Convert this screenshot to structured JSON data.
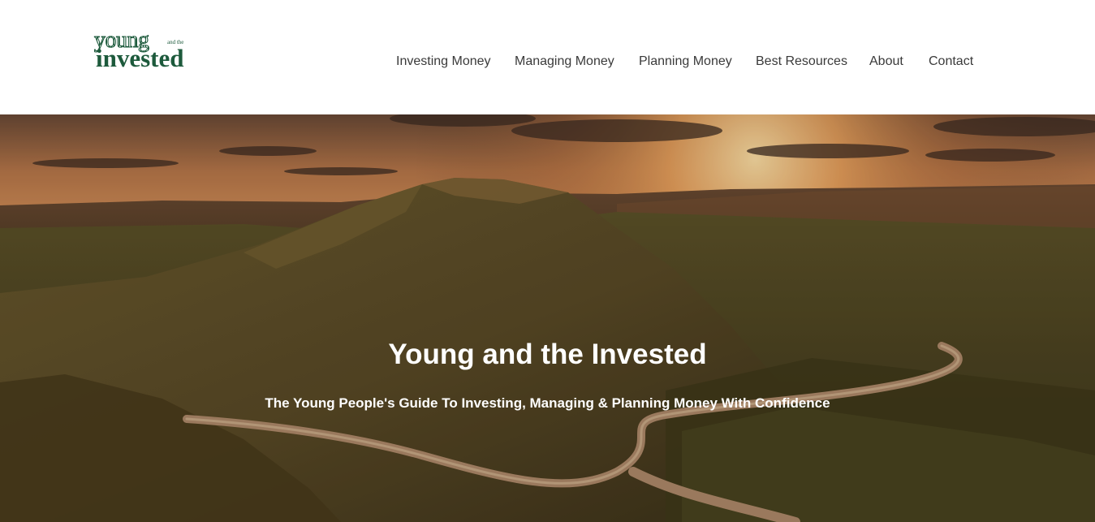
{
  "logo": {
    "line1": "young",
    "small": "and the",
    "line2": "invested"
  },
  "nav": {
    "items": [
      {
        "label": "Investing Money"
      },
      {
        "label": "Managing Money"
      },
      {
        "label": "Planning Money"
      },
      {
        "label": "Best Resources"
      },
      {
        "label": "About"
      },
      {
        "label": "Contact"
      }
    ]
  },
  "hero": {
    "title": "Young and the Invested",
    "subtitle": "The Young People's Guide To Investing, Managing & Planning Money With Confidence"
  },
  "colors": {
    "brand": "#1d5a3c",
    "nav_text": "#3a3a3a",
    "hero_text": "#ffffff"
  }
}
